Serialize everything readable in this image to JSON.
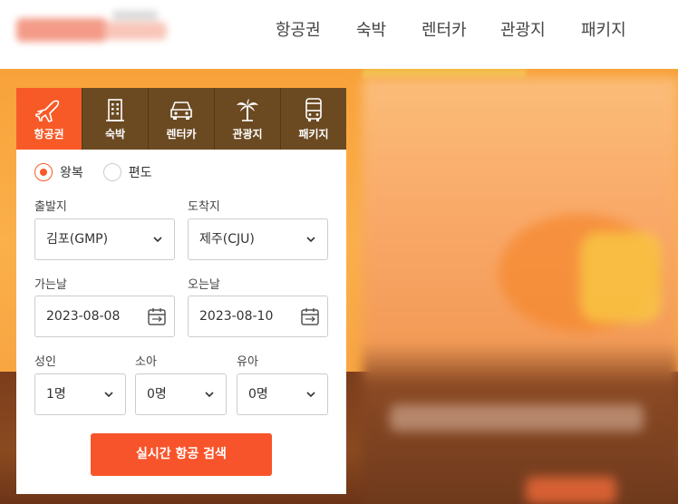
{
  "header": {
    "nav": [
      {
        "label": "항공권"
      },
      {
        "label": "숙박"
      },
      {
        "label": "렌터카"
      },
      {
        "label": "관광지"
      },
      {
        "label": "패키지"
      }
    ]
  },
  "search": {
    "tabs": [
      {
        "label": "항공권",
        "icon": "airplane-icon",
        "active": true
      },
      {
        "label": "숙박",
        "icon": "building-icon",
        "active": false
      },
      {
        "label": "렌터카",
        "icon": "car-icon",
        "active": false
      },
      {
        "label": "관광지",
        "icon": "palm-tree-icon",
        "active": false
      },
      {
        "label": "패키지",
        "icon": "bus-icon",
        "active": false
      }
    ],
    "trip_type": {
      "options": [
        {
          "label": "왕복",
          "checked": true
        },
        {
          "label": "편도",
          "checked": false
        }
      ]
    },
    "departure": {
      "label": "출발지",
      "value": "김포(GMP)"
    },
    "arrival": {
      "label": "도착지",
      "value": "제주(CJU)"
    },
    "depart_date": {
      "label": "가는날",
      "value": "2023-08-08"
    },
    "return_date": {
      "label": "오는날",
      "value": "2023-08-10"
    },
    "passengers": [
      {
        "label": "성인",
        "value": "1명"
      },
      {
        "label": "소아",
        "value": "0명"
      },
      {
        "label": "유아",
        "value": "0명"
      }
    ],
    "submit_label": "실시간 항공 검색"
  },
  "colors": {
    "accent": "#f85a27",
    "tab_bg": "#6b4a22",
    "hero": "#f8a23a"
  }
}
